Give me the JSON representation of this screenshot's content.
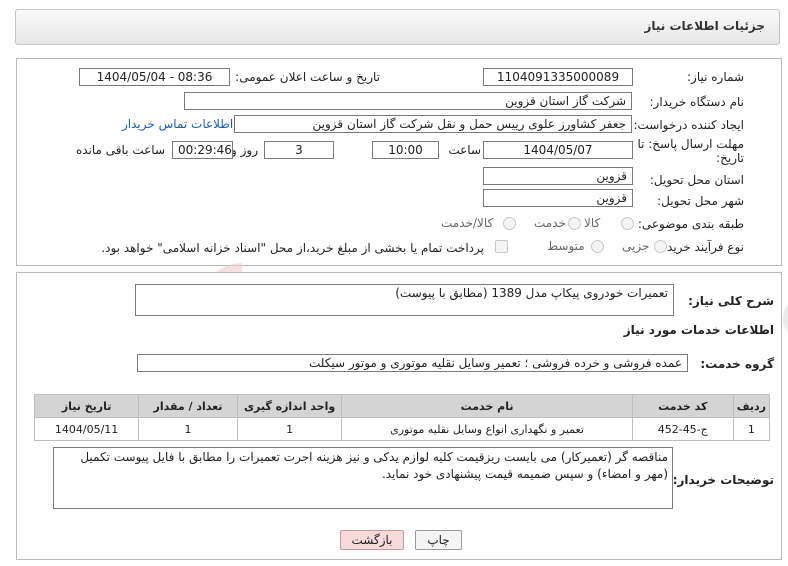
{
  "header": {
    "title": "جزئیات اطلاعات نیاز"
  },
  "form": {
    "need_number_label": "شماره نیاز:",
    "need_number": "1104091335000089",
    "announce_label": "تاریخ و ساعت اعلان عمومی:",
    "announce_value": "1404/05/04 - 08:36",
    "buyer_org_label": "نام دستگاه خریدار:",
    "buyer_org": "شرکت گاز استان قزوین",
    "creator_label": "ایجاد کننده درخواست:",
    "creator": "جعفر کشاورز علوی رییس حمل و نقل شرکت گاز استان قزوین",
    "contact_link": "اطلاعات تماس خریدار",
    "deadline_label_1": "مهلت ارسال پاسخ: تا",
    "deadline_label_2": "تاریخ:",
    "deadline_date": "1404/05/07",
    "time_label": "ساعت",
    "deadline_time": "10:00",
    "days_value": "3",
    "days_label": "روز و",
    "remaining_time": "00:29:46",
    "remaining_label": "ساعت باقی مانده",
    "province_label": "استان محل تحویل:",
    "province": "قزوین",
    "city_label": "شهر محل تحویل:",
    "city": "قزوین",
    "category_label": "طبقه بندی موضوعی:",
    "category_options": [
      "کالا",
      "خدمت",
      "کالا/خدمت"
    ],
    "process_label": "نوع فرآیند خرید :",
    "process_options": [
      "جزیی",
      "متوسط"
    ],
    "payment_note": "پرداخت تمام یا بخشی از مبلغ خرید،از محل \"اسناد خزانه اسلامی\" خواهد بود."
  },
  "summary": {
    "label": "شرح کلی نیاز:",
    "text": "تعمیرات خودروی پیکاپ مدل 1389 (مطابق با پیوست)"
  },
  "services": {
    "section_title": "اطلاعات خدمات مورد نیاز",
    "group_label": "گروه خدمت:",
    "group_value": "عمده فروشی و خرده فروشی ؛ تعمیر وسایل نقلیه موتوری و موتور سیکلت",
    "columns": [
      "ردیف",
      "کد خدمت",
      "نام خدمت",
      "واحد اندازه گیری",
      "تعداد / مقدار",
      "تاریخ نیاز"
    ],
    "rows": [
      {
        "row": "1",
        "code": "ج-45-452",
        "name": "تعمیر و نگهداری انواع وسایل نقلیه موتوری",
        "unit": "1",
        "qty": "1",
        "date": "1404/05/11"
      }
    ]
  },
  "buyer_notes": {
    "label": "توضیحات خریدار:",
    "text": "مناقصه گر (تعمیرکار) می بایست ریزقیمت کلیه لوازم یدکی و نیز هزینه اجرت تعمیرات را مطابق با فایل پیوست تکمیل (مهر و امضاء) و سپس ضمیمه قیمت پیشنهادی خود نماید."
  },
  "buttons": {
    "print": "چاپ",
    "back": "بازگشت"
  },
  "colors": {
    "link": "#1a5fb4",
    "back_button": "#f7dada",
    "table_header": "#d4d4d4"
  }
}
